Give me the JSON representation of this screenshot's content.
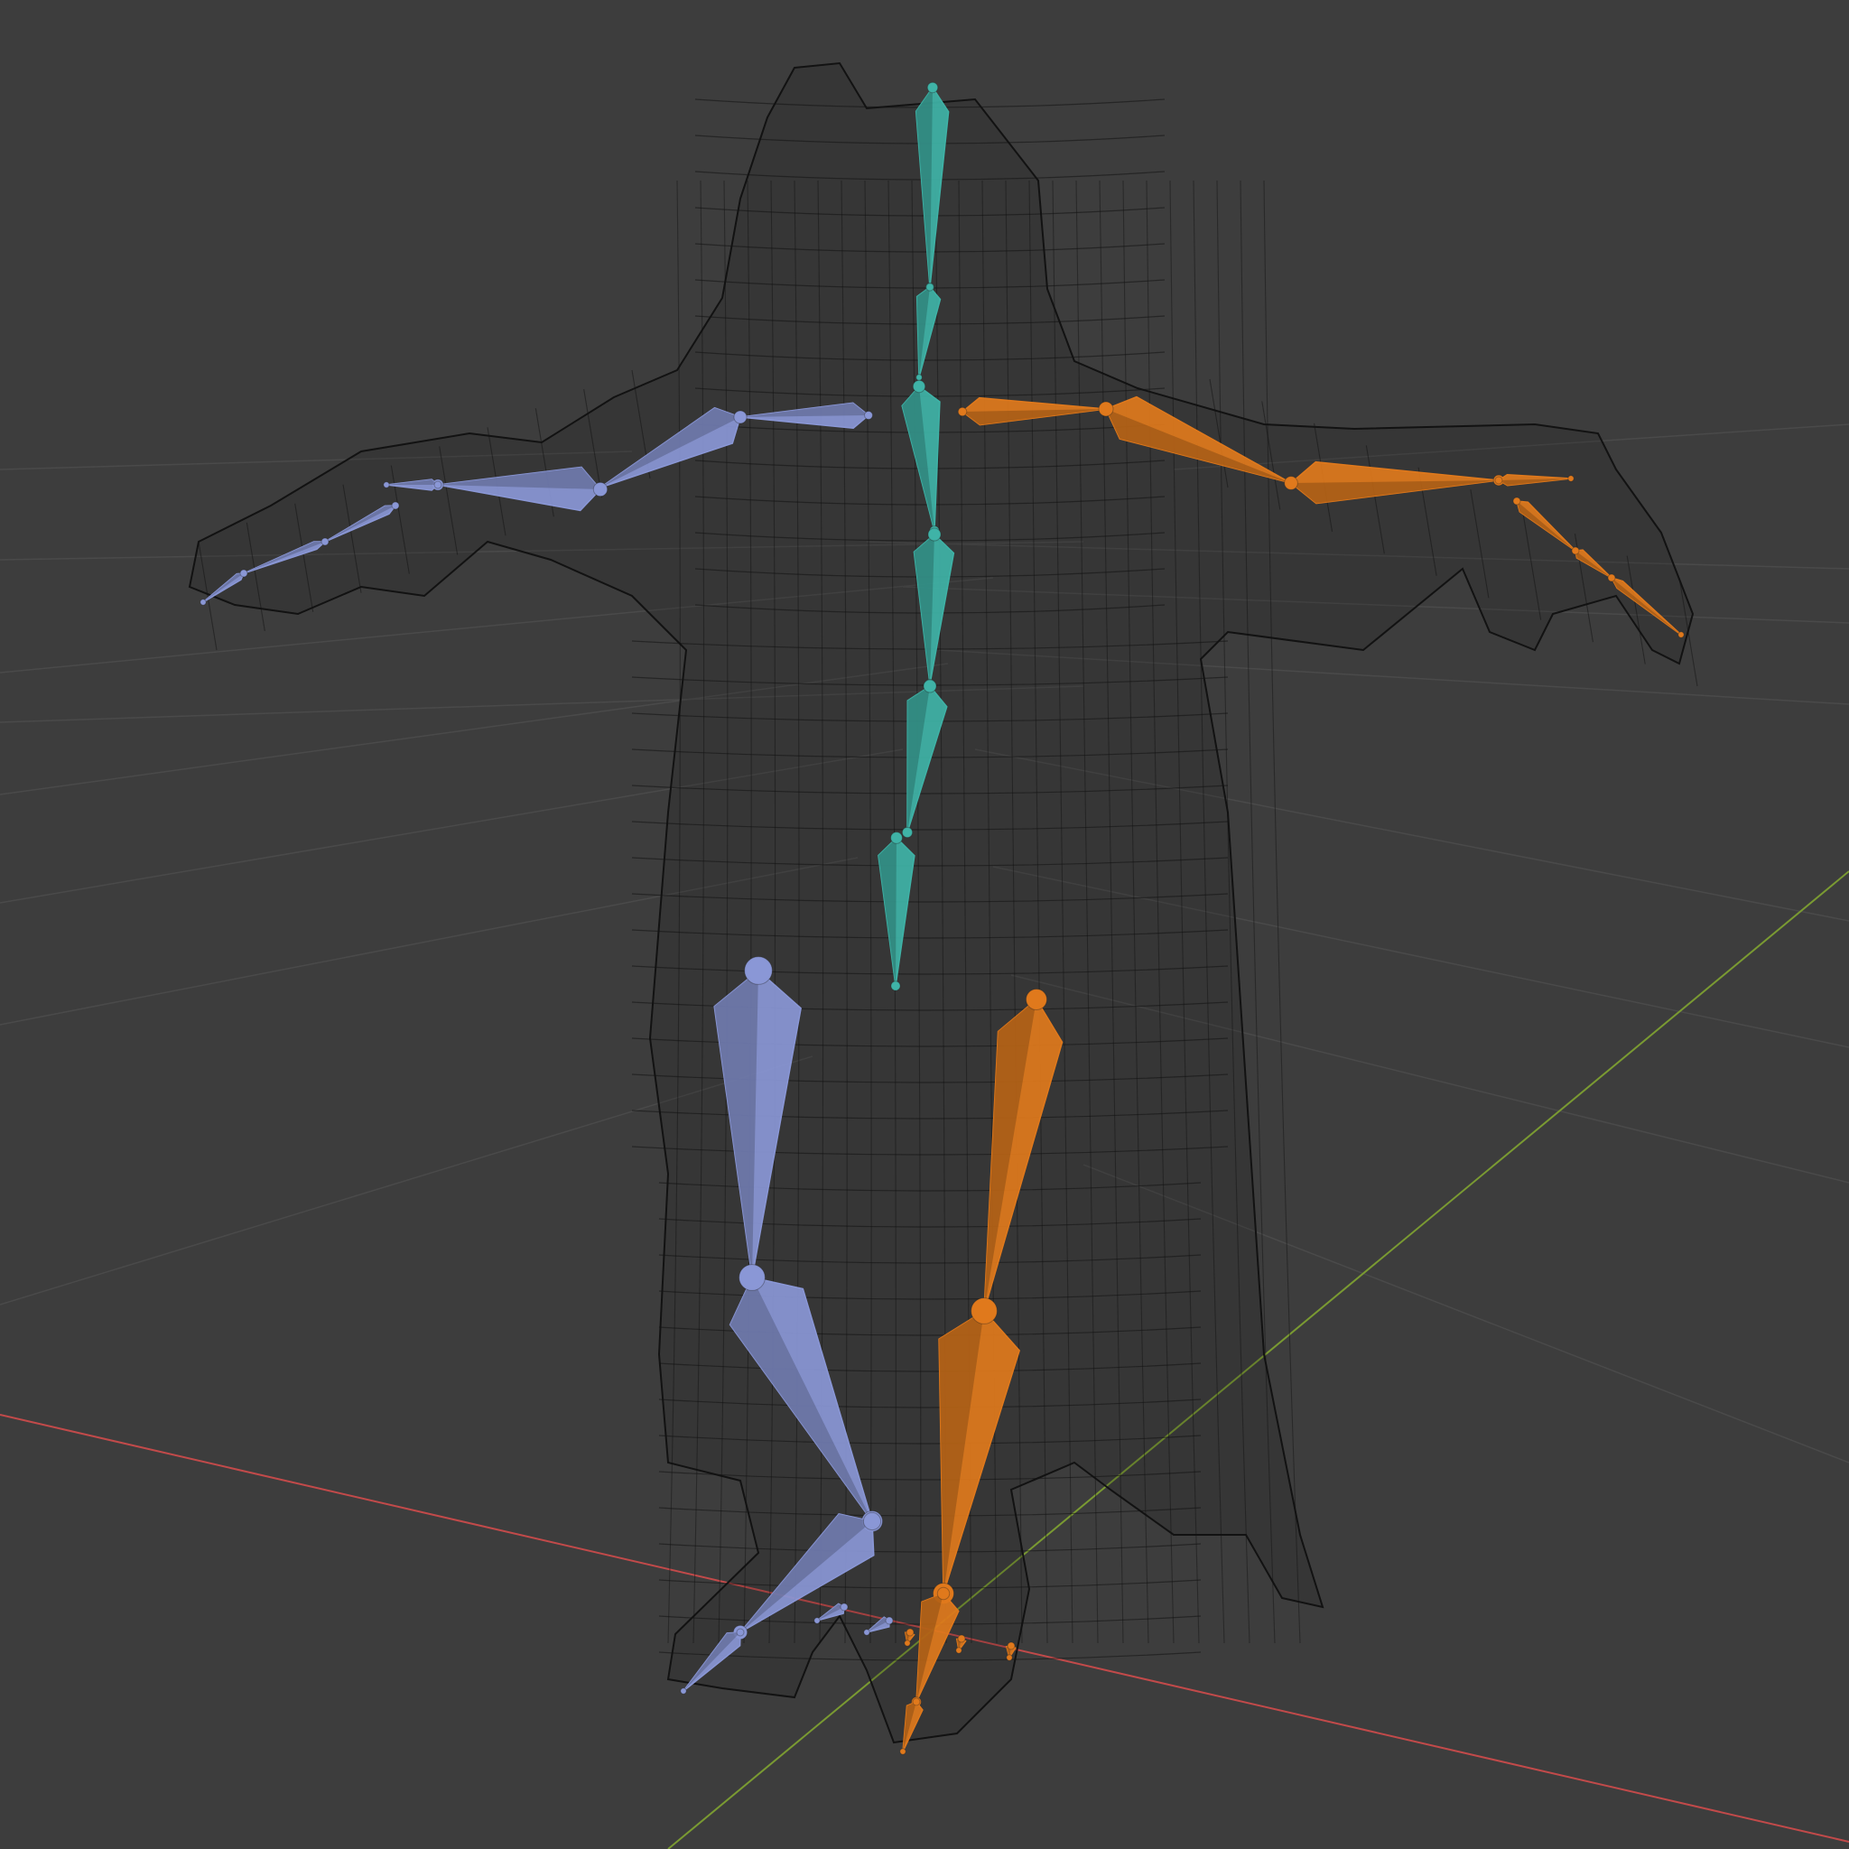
{
  "viewport": {
    "name": "3d-viewport",
    "background": "#3d3d3d",
    "grid_color": "#4a4a4a",
    "x_axis_color": "#c24a4a",
    "y_axis_color": "#7a9a32",
    "wire_color": "#121212"
  },
  "armature": {
    "spine_color": "#3fb3a7",
    "left_side_color": "#8a97d6",
    "right_side_color": "#e0791c",
    "bone_groups": [
      "spine",
      "left-arm",
      "right-arm",
      "left-leg",
      "right-leg",
      "left-hand-fingers",
      "right-hand-fingers",
      "left-foot-toes",
      "right-foot-toes"
    ]
  }
}
